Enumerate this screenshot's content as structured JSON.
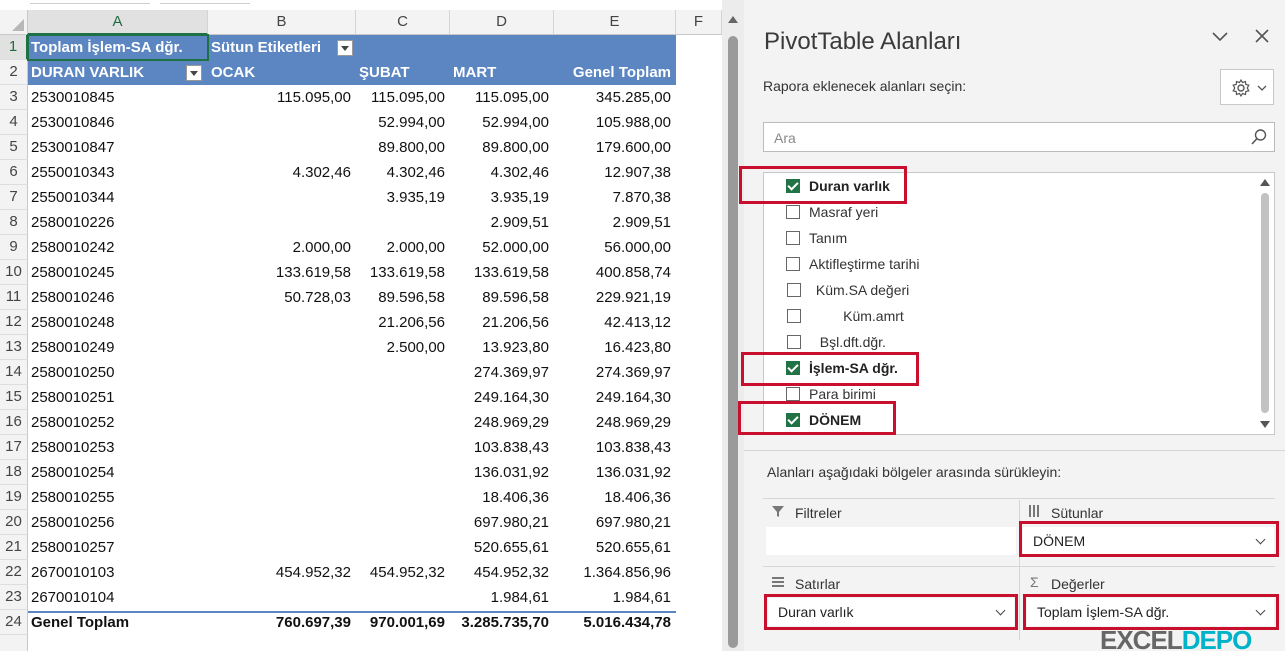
{
  "sheet": {
    "columns": [
      "A",
      "B",
      "C",
      "D",
      "E",
      "F"
    ],
    "header_row1": {
      "a": "Toplam  İşlem-SA dğr.",
      "b": "Sütun Etiketleri"
    },
    "header_row2": {
      "a": "DURAN VARLIK",
      "b": "OCAK",
      "c": "ŞUBAT",
      "d": "MART",
      "e": "Genel Toplam"
    },
    "rows": [
      {
        "n": "3",
        "a": "2530010845",
        "b": "115.095,00",
        "c": "115.095,00",
        "d": "115.095,00",
        "e": "345.285,00"
      },
      {
        "n": "4",
        "a": "2530010846",
        "b": "",
        "c": "52.994,00",
        "d": "52.994,00",
        "e": "105.988,00"
      },
      {
        "n": "5",
        "a": "2530010847",
        "b": "",
        "c": "89.800,00",
        "d": "89.800,00",
        "e": "179.600,00"
      },
      {
        "n": "6",
        "a": "2550010343",
        "b": "4.302,46",
        "c": "4.302,46",
        "d": "4.302,46",
        "e": "12.907,38"
      },
      {
        "n": "7",
        "a": "2550010344",
        "b": "",
        "c": "3.935,19",
        "d": "3.935,19",
        "e": "7.870,38"
      },
      {
        "n": "8",
        "a": "2580010226",
        "b": "",
        "c": "",
        "d": "2.909,51",
        "e": "2.909,51"
      },
      {
        "n": "9",
        "a": "2580010242",
        "b": "2.000,00",
        "c": "2.000,00",
        "d": "52.000,00",
        "e": "56.000,00"
      },
      {
        "n": "10",
        "a": "2580010245",
        "b": "133.619,58",
        "c": "133.619,58",
        "d": "133.619,58",
        "e": "400.858,74"
      },
      {
        "n": "11",
        "a": "2580010246",
        "b": "50.728,03",
        "c": "89.596,58",
        "d": "89.596,58",
        "e": "229.921,19"
      },
      {
        "n": "12",
        "a": "2580010248",
        "b": "",
        "c": "21.206,56",
        "d": "21.206,56",
        "e": "42.413,12"
      },
      {
        "n": "13",
        "a": "2580010249",
        "b": "",
        "c": "2.500,00",
        "d": "13.923,80",
        "e": "16.423,80"
      },
      {
        "n": "14",
        "a": "2580010250",
        "b": "",
        "c": "",
        "d": "274.369,97",
        "e": "274.369,97"
      },
      {
        "n": "15",
        "a": "2580010251",
        "b": "",
        "c": "",
        "d": "249.164,30",
        "e": "249.164,30"
      },
      {
        "n": "16",
        "a": "2580010252",
        "b": "",
        "c": "",
        "d": "248.969,29",
        "e": "248.969,29"
      },
      {
        "n": "17",
        "a": "2580010253",
        "b": "",
        "c": "",
        "d": "103.838,43",
        "e": "103.838,43"
      },
      {
        "n": "18",
        "a": "2580010254",
        "b": "",
        "c": "",
        "d": "136.031,92",
        "e": "136.031,92"
      },
      {
        "n": "19",
        "a": "2580010255",
        "b": "",
        "c": "",
        "d": "18.406,36",
        "e": "18.406,36"
      },
      {
        "n": "20",
        "a": "2580010256",
        "b": "",
        "c": "",
        "d": "697.980,21",
        "e": "697.980,21"
      },
      {
        "n": "21",
        "a": "2580010257",
        "b": "",
        "c": "",
        "d": "520.655,61",
        "e": "520.655,61"
      },
      {
        "n": "22",
        "a": "2670010103",
        "b": "454.952,32",
        "c": "454.952,32",
        "d": "454.952,32",
        "e": "1.364.856,96"
      },
      {
        "n": "23",
        "a": "2670010104",
        "b": "",
        "c": "",
        "d": "1.984,61",
        "e": "1.984,61"
      },
      {
        "n": "24",
        "a": "Genel Toplam",
        "b": "760.697,39",
        "c": "970.001,69",
        "d": "3.285.735,70",
        "e": "5.016.434,78"
      }
    ]
  },
  "pane": {
    "title": "PivotTable Alanları",
    "subtitle": "Rapora eklenecek alanları seçin:",
    "search_placeholder": "Ara",
    "fields": [
      {
        "label": "Duran varlık",
        "checked": true
      },
      {
        "label": "Masraf yeri",
        "checked": false
      },
      {
        "label": "Tanım",
        "checked": false
      },
      {
        "label": "Aktifleştirme tarihi",
        "checked": false
      },
      {
        "label": " Küm.SA değeri",
        "checked": false
      },
      {
        "label": "        Küm.amrt",
        "checked": false
      },
      {
        "label": "  Bşl.dft.dğr.",
        "checked": false
      },
      {
        "label": "İşlem-SA dğr.",
        "checked": true
      },
      {
        "label": "Para birimi",
        "checked": false
      },
      {
        "label": "DÖNEM",
        "checked": true
      }
    ],
    "drag_text": "Alanları aşağıdaki bölgeler arasında sürükleyin:",
    "areas": {
      "filters": {
        "label": "Filtreler"
      },
      "columns": {
        "label": "Sütunlar",
        "value": "DÖNEM"
      },
      "rows": {
        "label": "Satırlar",
        "value": "Duran varlık"
      },
      "values": {
        "label": "Değerler",
        "value": "Toplam  İşlem-SA dğr."
      }
    },
    "highlight_color": "#c8102e",
    "check_color": "#217346"
  },
  "watermark": {
    "part1": "EXCEL",
    "part2": "DEPO"
  },
  "colors": {
    "pivot_header": "#5b86c2",
    "excel_green": "#1e7145"
  }
}
